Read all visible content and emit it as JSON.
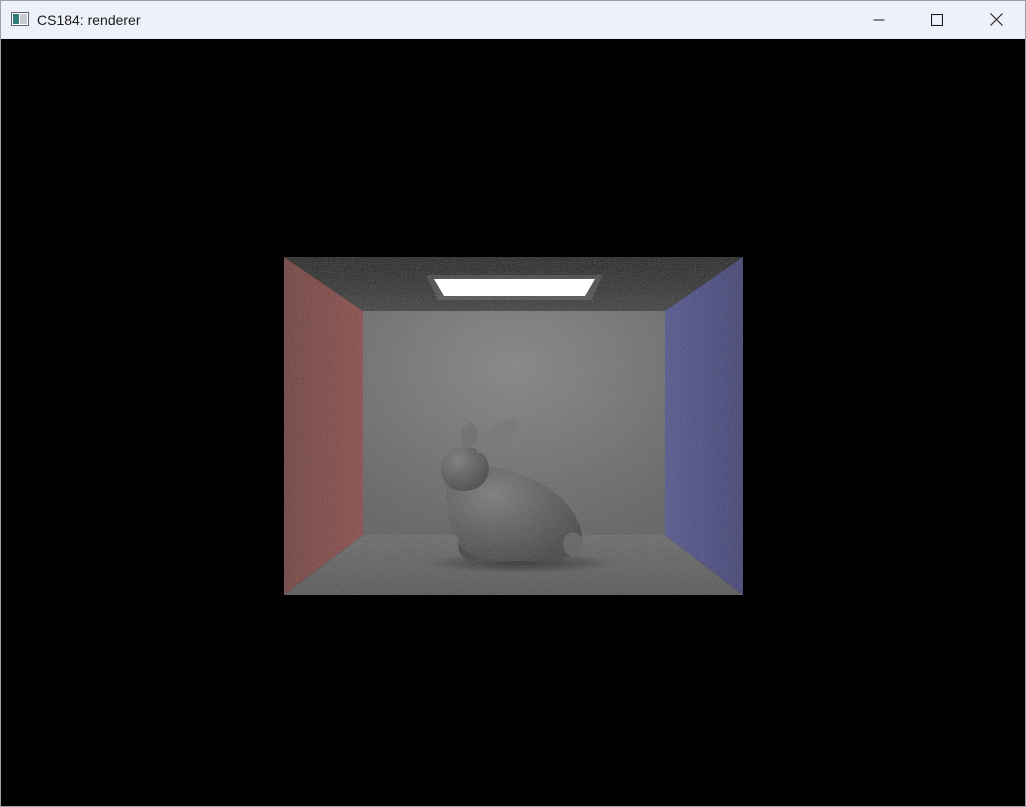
{
  "window": {
    "title": "CS184: renderer",
    "app_icon": "app-window-icon",
    "controls": {
      "minimize": "minimize-icon",
      "maximize": "maximize-icon",
      "close": "close-icon"
    }
  },
  "scene": {
    "description_icon": "cornell-box-render",
    "colors": {
      "background": "#000000",
      "left_wall": "#7a3f3c",
      "right_wall": "#43457e",
      "back_wall": "#6e6e6e",
      "floor": "#5c5c5c",
      "ceiling": "#1f1f1f",
      "light": "#ffffff",
      "bunny": "#5a5a5a"
    }
  }
}
